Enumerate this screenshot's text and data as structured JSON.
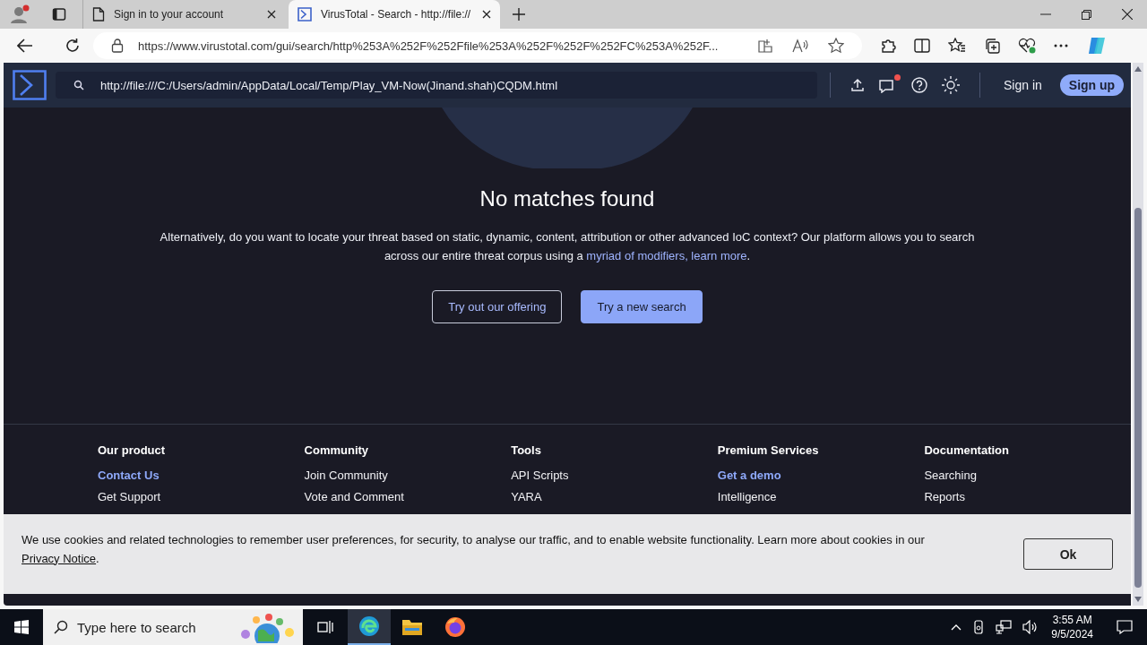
{
  "browser": {
    "tabs": [
      {
        "title": "Sign in to your account",
        "kind": "page",
        "selected": false
      },
      {
        "title": "VirusTotal - Search - http://file://",
        "kind": "vt",
        "selected": true
      }
    ],
    "address": "https://www.virustotal.com/gui/search/http%253A%252F%252Ffile%253A%252F%252F%252FC%253A%252F..."
  },
  "site_header": {
    "search_value": "http://file:///C:/Users/admin/AppData/Local/Temp/Play_VM-Now(Jinand.shah)CQDM.html",
    "notification": true,
    "sign_in": "Sign in",
    "sign_up": "Sign up"
  },
  "results": {
    "title": "No matches found",
    "text_before": "Alternatively, do you want to locate your threat based on static, dynamic, content, attribution or other advanced IoC context? Our platform allows you to search across our entire threat corpus using a",
    "link": "myriad of modifiers, learn more",
    "text_after": ".",
    "buttons": [
      {
        "label": "Try out our offering",
        "kind": "outline"
      },
      {
        "label": "Try a new search",
        "kind": "filled"
      }
    ]
  },
  "footer": {
    "columns": [
      {
        "heading": "Our product",
        "links": [
          {
            "label": "Contact Us",
            "highlight": true
          },
          {
            "label": "Get Support",
            "highlight": false
          }
        ]
      },
      {
        "heading": "Community",
        "links": [
          {
            "label": "Join Community",
            "highlight": false
          },
          {
            "label": "Vote and Comment",
            "highlight": false
          }
        ]
      },
      {
        "heading": "Tools",
        "links": [
          {
            "label": "API Scripts",
            "highlight": false
          },
          {
            "label": "YARA",
            "highlight": false
          }
        ]
      },
      {
        "heading": "Premium Services",
        "links": [
          {
            "label": "Get a demo",
            "highlight": true
          },
          {
            "label": "Intelligence",
            "highlight": false
          }
        ]
      },
      {
        "heading": "Documentation",
        "links": [
          {
            "label": "Searching",
            "highlight": false
          },
          {
            "label": "Reports",
            "highlight": false
          }
        ]
      }
    ]
  },
  "cookie_banner": {
    "text": "We use cookies and related technologies to remember user preferences, for security, to analyse our traffic, and to enable website functionality. Learn more about cookies in our",
    "link": "Privacy Notice",
    "text_after": ".",
    "button": "Ok"
  },
  "taskbar": {
    "search_placeholder": "Type here to search",
    "time": "3:55 AM",
    "date": "9/5/2024"
  }
}
